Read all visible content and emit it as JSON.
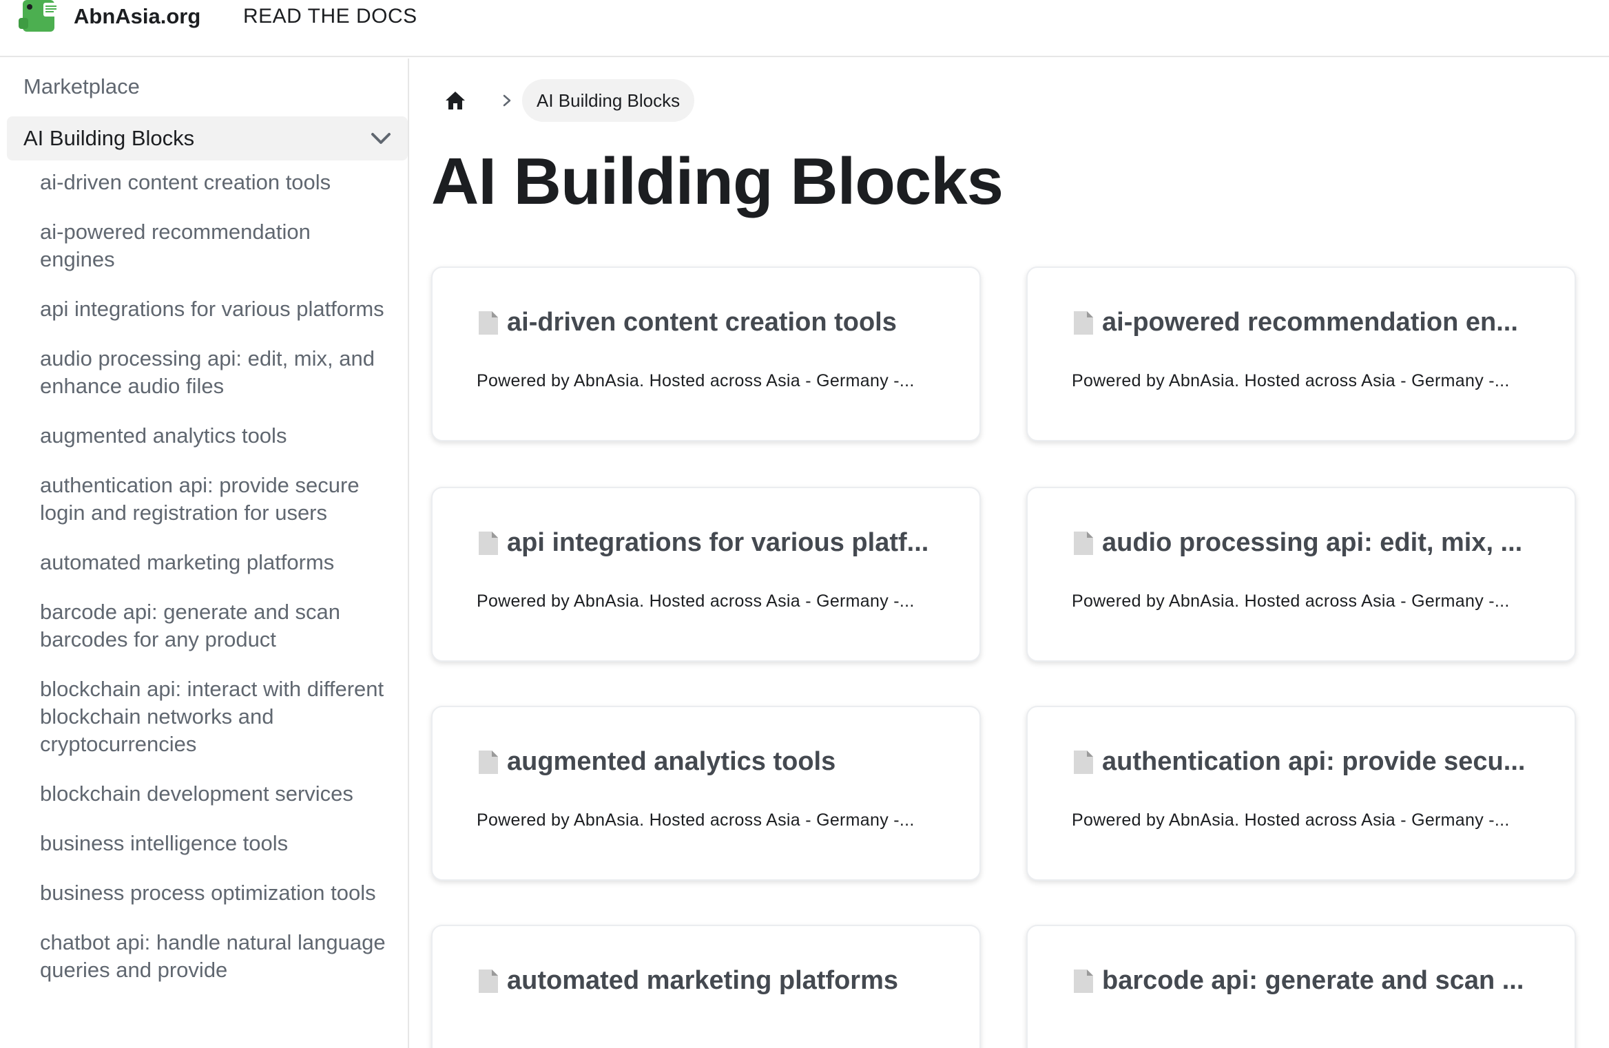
{
  "navbar": {
    "brand_title": "AbnAsia.org",
    "docs_link": "READ THE DOCS"
  },
  "sidebar": {
    "top_item": "Marketplace",
    "category": {
      "label": "AI Building Blocks",
      "expanded": true
    },
    "items": [
      {
        "label": "ai-driven content creation tools"
      },
      {
        "label": "ai-powered recommendation engines"
      },
      {
        "label": "api integrations for various platforms"
      },
      {
        "label": "audio processing api: edit, mix, and enhance audio files"
      },
      {
        "label": "augmented analytics tools"
      },
      {
        "label": "authentication api: provide secure login and registration for users"
      },
      {
        "label": "automated marketing platforms"
      },
      {
        "label": "barcode api: generate and scan barcodes for any product"
      },
      {
        "label": "blockchain api: interact with different blockchain networks and cryptocurrencies"
      },
      {
        "label": "blockchain development services"
      },
      {
        "label": "business intelligence tools"
      },
      {
        "label": "business process optimization tools"
      },
      {
        "label": "chatbot api: handle natural language queries and provide"
      }
    ]
  },
  "breadcrumbs": {
    "home_icon": "home-icon",
    "current": "AI Building Blocks"
  },
  "main": {
    "title": "AI Building Blocks",
    "cards": [
      {
        "title": "ai-driven content creation tools",
        "description": "Powered by AbnAsia. Hosted across Asia - Germany -..."
      },
      {
        "title": "ai-powered recommendation en...",
        "description": "Powered by AbnAsia. Hosted across Asia - Germany -..."
      },
      {
        "title": "api integrations for various platf...",
        "description": "Powered by AbnAsia. Hosted across Asia - Germany -..."
      },
      {
        "title": "audio processing api: edit, mix, ...",
        "description": "Powered by AbnAsia. Hosted across Asia - Germany -..."
      },
      {
        "title": "augmented analytics tools",
        "description": "Powered by AbnAsia. Hosted across Asia - Germany -..."
      },
      {
        "title": "authentication api: provide secu...",
        "description": "Powered by AbnAsia. Hosted across Asia - Germany -..."
      },
      {
        "title": "automated marketing platforms",
        "description": ""
      },
      {
        "title": "barcode api: generate and scan ...",
        "description": ""
      }
    ]
  },
  "colors": {
    "sidebar_text": "#606770",
    "active_background": "#f2f2f2",
    "card_title": "#444950",
    "border": "#e6e6e6",
    "logo_green": "#4caf50"
  }
}
